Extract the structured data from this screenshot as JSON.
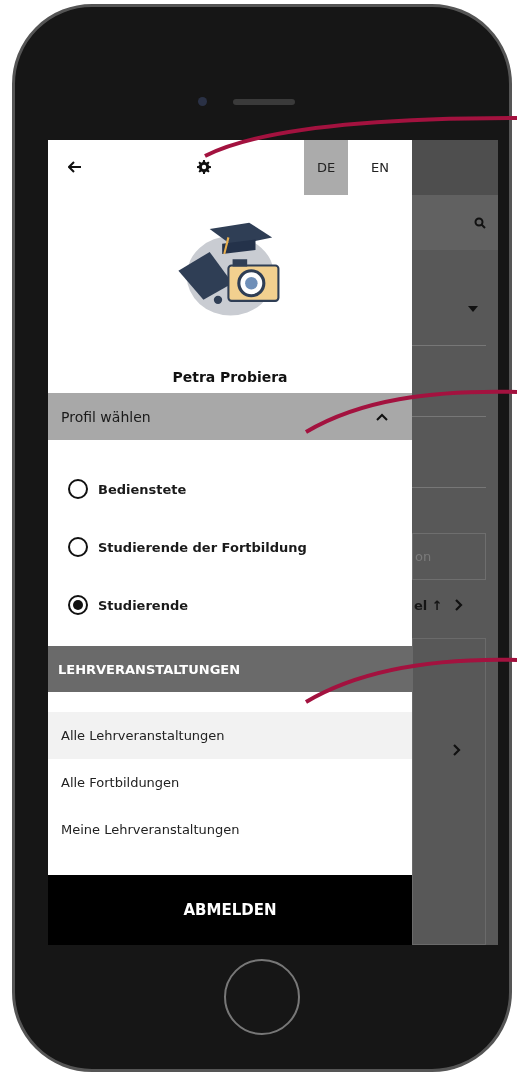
{
  "top_bar": {
    "languages": [
      {
        "label": "DE",
        "selected": true
      },
      {
        "label": "EN",
        "selected": false
      }
    ]
  },
  "user": {
    "name": "Petra Probiera"
  },
  "profile_section": {
    "title": "Profil wählen",
    "expanded": true,
    "options": [
      {
        "label": "Bedienstete",
        "selected": false
      },
      {
        "label": "Studierende der Fortbildung",
        "selected": false
      },
      {
        "label": "Studierende",
        "selected": true
      }
    ]
  },
  "courses_section": {
    "title": "LEHRVERANSTALTUNGEN",
    "items": [
      {
        "label": "Alle Lehrveranstaltungen",
        "selected": true
      },
      {
        "label": "Alle Fortbildungen",
        "selected": false
      },
      {
        "label": "Meine Lehrveranstaltungen",
        "selected": false
      }
    ]
  },
  "logout_button": "ABMELDEN",
  "background": {
    "field_text": "on",
    "sort_text": "el ↑"
  }
}
